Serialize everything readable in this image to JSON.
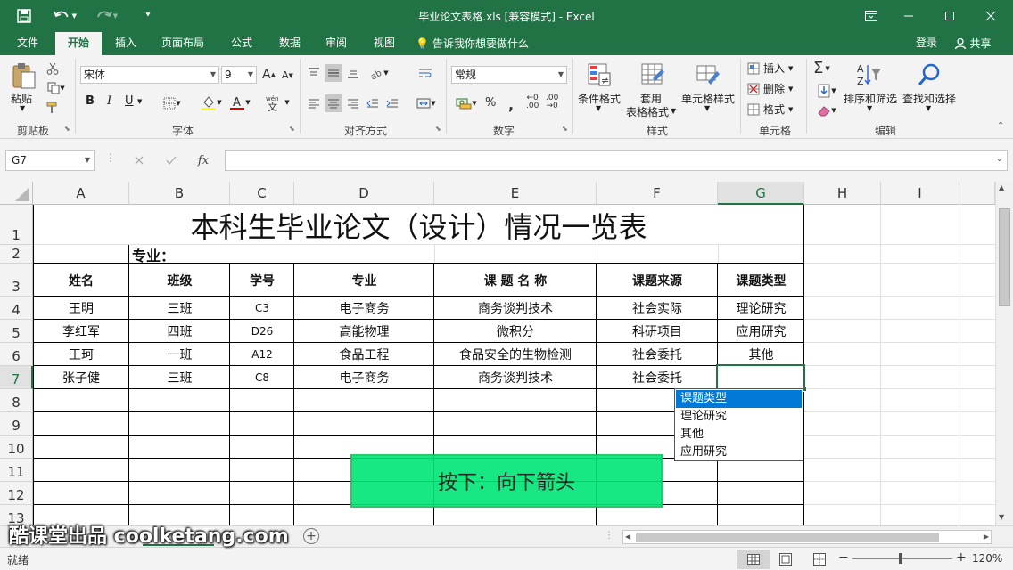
{
  "window": {
    "title": "毕业论文表格.xls [兼容模式] - Excel",
    "colors": {
      "brand": "#217346",
      "ribbon": "#f3f3f3",
      "select": "#0078d7",
      "overlay": "#00e676"
    }
  },
  "tabs": [
    "文件",
    "开始",
    "插入",
    "页面布局",
    "公式",
    "数据",
    "审阅",
    "视图"
  ],
  "tell_me": "告诉我你想要做什么",
  "login": "登录",
  "share": "共享",
  "ribbon": {
    "clipboard": {
      "label": "剪贴板",
      "paste": "粘贴"
    },
    "font": {
      "label": "字体",
      "name": "宋体",
      "size": "9",
      "bold": "B",
      "italic": "I",
      "underline": "U"
    },
    "alignment": {
      "label": "对齐方式"
    },
    "number": {
      "label": "数字",
      "format": "常规"
    },
    "styles": {
      "label": "样式",
      "conditional": "条件格式",
      "table1": "套用",
      "table2": "表格格式",
      "cell_styles": "单元格样式"
    },
    "cells": {
      "label": "单元格",
      "insert": "插入",
      "delete": "删除",
      "format": "格式"
    },
    "editing": {
      "label": "编辑",
      "sort": "排序和筛选",
      "find": "查找和选择"
    }
  },
  "formula_bar": {
    "name_box": "G7",
    "fx": "fx",
    "value": ""
  },
  "columns": [
    "A",
    "B",
    "C",
    "D",
    "E",
    "F",
    "G",
    "H",
    "I"
  ],
  "rows": [
    "1",
    "2",
    "3",
    "4",
    "5",
    "6",
    "7",
    "8",
    "9",
    "10",
    "11",
    "12",
    "13"
  ],
  "sheet": {
    "title": "本科生毕业论文（设计）情况一览表",
    "major_label": "专业：",
    "headers": [
      "姓名",
      "班级",
      "学号",
      "专业",
      "课 题 名 称",
      "课题来源",
      "课题类型"
    ],
    "data": [
      [
        "王明",
        "三班",
        "C3",
        "电子商务",
        "商务谈判技术",
        "社会实际",
        "理论研究"
      ],
      [
        "李红军",
        "四班",
        "D26",
        "高能物理",
        "微积分",
        "科研项目",
        "应用研究"
      ],
      [
        "王珂",
        "一班",
        "A12",
        "食品工程",
        "食品安全的生物检测",
        "社会委托",
        "其他"
      ],
      [
        "张子健",
        "三班",
        "C8",
        "电子商务",
        "商务谈判技术",
        "社会委托",
        ""
      ]
    ]
  },
  "dropdown": {
    "options": [
      "课题类型",
      "理论研究",
      "其他",
      "应用研究"
    ]
  },
  "overlay": {
    "text": "按下：向下箭头"
  },
  "watermark": "酷课堂出品 coolketang.com",
  "status": {
    "ready": "就绪",
    "zoom": "120%"
  }
}
